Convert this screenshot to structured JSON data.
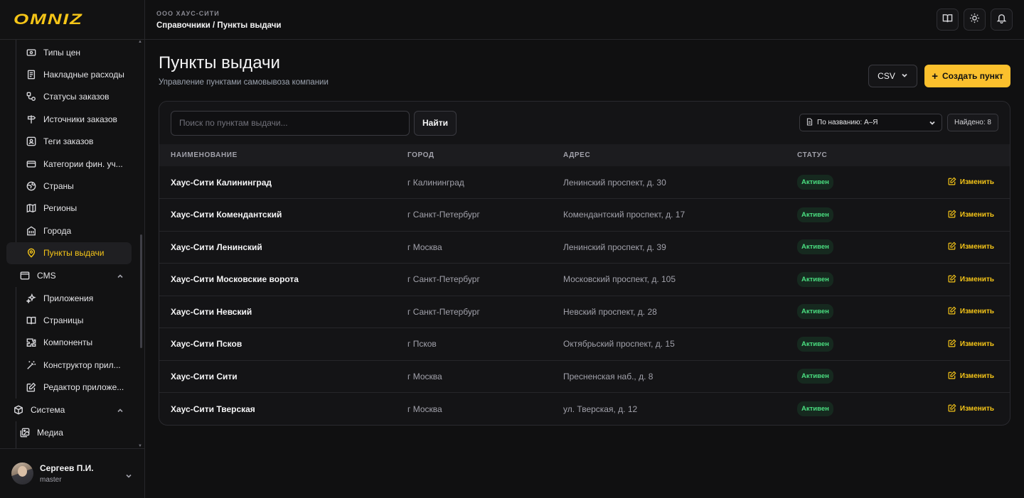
{
  "brand": {
    "logo": "OMNIZ",
    "accent": "#f5c518"
  },
  "sidebar": {
    "items": [
      {
        "label": "Типы цен",
        "icon": "banknote-icon",
        "active": false
      },
      {
        "label": "Накладные расходы",
        "icon": "receipt-icon",
        "active": false
      },
      {
        "label": "Статусы заказов",
        "icon": "status-flow-icon",
        "active": false
      },
      {
        "label": "Источники заказов",
        "icon": "signpost-icon",
        "active": false
      },
      {
        "label": "Теги заказов",
        "icon": "tag-icon",
        "active": false
      },
      {
        "label": "Категории фин. уч...",
        "icon": "card-icon",
        "active": false
      },
      {
        "label": "Страны",
        "icon": "globe-icon",
        "active": false
      },
      {
        "label": "Регионы",
        "icon": "map-icon",
        "active": false
      },
      {
        "label": "Города",
        "icon": "building-icon",
        "active": false
      },
      {
        "label": "Пункты выдачи",
        "icon": "map-pin-icon",
        "active": true
      }
    ],
    "cms_group": {
      "label": "CMS",
      "icon": "window-icon"
    },
    "cms_items": [
      {
        "label": "Приложения",
        "icon": "sparkles-icon"
      },
      {
        "label": "Страницы",
        "icon": "book-open-icon"
      },
      {
        "label": "Компоненты",
        "icon": "puzzle-icon"
      },
      {
        "label": "Конструктор прил...",
        "icon": "wand-icon"
      },
      {
        "label": "Редактор приложе...",
        "icon": "edit-icon"
      }
    ],
    "system_group": {
      "label": "Система",
      "icon": "package-icon"
    },
    "system_items": [
      {
        "label": "Медиа",
        "icon": "images-icon"
      }
    ],
    "user": {
      "name": "Сергеев П.И.",
      "role": "master"
    }
  },
  "topbar": {
    "org": "ООО ХАУС-СИТИ",
    "breadcrumb": "Справочники / Пункты выдачи"
  },
  "page": {
    "title": "Пункты выдачи",
    "subtitle": "Управление пунктами самовывоза компании",
    "csv_label": "CSV",
    "create_label": "Создать пункт"
  },
  "toolbar": {
    "search_placeholder": "Поиск по пунктам выдачи...",
    "find_label": "Найти",
    "sort_value": "По названию: А–Я",
    "found_label": "Найдено: 8"
  },
  "table": {
    "headers": [
      "НАИМЕНОВАНИЕ",
      "ГОРОД",
      "АДРЕС",
      "СТАТУС"
    ],
    "edit_label": "Изменить",
    "rows": [
      {
        "name": "Хаус-Сити Калининград",
        "city": "г Калининград",
        "address": "Ленинский проспект, д. 30",
        "status": "Активен"
      },
      {
        "name": "Хаус-Сити Комендантский",
        "city": "г Санкт-Петербург",
        "address": "Комендантский проспект, д. 17",
        "status": "Активен"
      },
      {
        "name": "Хаус-Сити Ленинский",
        "city": "г Москва",
        "address": "Ленинский проспект, д. 39",
        "status": "Активен"
      },
      {
        "name": "Хаус-Сити Московские ворота",
        "city": "г Санкт-Петербург",
        "address": "Московский проспект, д. 105",
        "status": "Активен"
      },
      {
        "name": "Хаус-Сити Невский",
        "city": "г Санкт-Петербург",
        "address": "Невский проспект, д. 28",
        "status": "Активен"
      },
      {
        "name": "Хаус-Сити Псков",
        "city": "г Псков",
        "address": "Октябрьский проспект, д. 15",
        "status": "Активен"
      },
      {
        "name": "Хаус-Сити Сити",
        "city": "г Москва",
        "address": "Пресненская наб., д. 8",
        "status": "Активен"
      },
      {
        "name": "Хаус-Сити Тверская",
        "city": "г Москва",
        "address": "ул. Тверская, д. 12",
        "status": "Активен"
      }
    ]
  }
}
